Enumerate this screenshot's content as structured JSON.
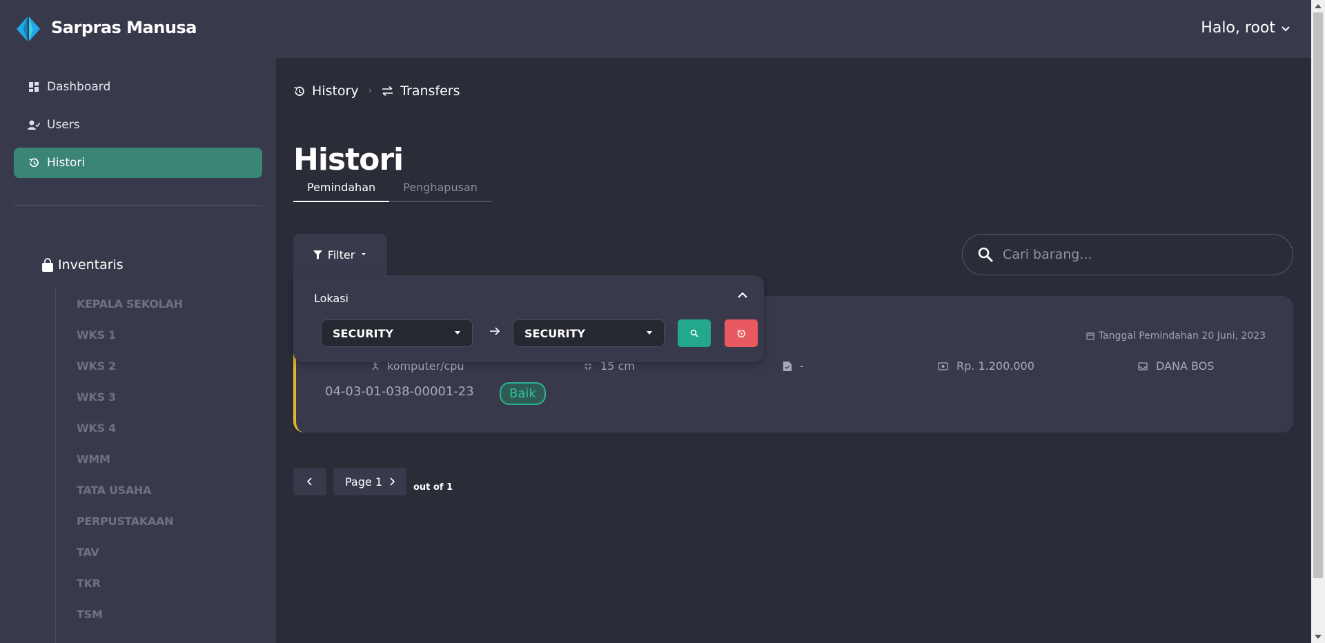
{
  "app": {
    "brand": "Sarpras Manusa",
    "user_greeting": "Halo, root"
  },
  "sidebar": {
    "items": [
      {
        "label": "Dashboard",
        "icon": "dashboard-icon"
      },
      {
        "label": "Users",
        "icon": "user-check-icon"
      },
      {
        "label": "Histori",
        "icon": "history-icon"
      }
    ],
    "inventory_title": "Inventaris",
    "inventory_items": [
      "KEPALA SEKOLAH",
      "WKS 1",
      "WKS 2",
      "WKS 3",
      "WKS 4",
      "WMM",
      "TATA USAHA",
      "PERPUSTAKAAN",
      "TAV",
      "TKR",
      "TSM"
    ]
  },
  "breadcrumb": {
    "history": "History",
    "transfers": "Transfers"
  },
  "page": {
    "title": "Histori"
  },
  "tabs": [
    "Pemindahan",
    "Penghapusan"
  ],
  "filter": {
    "label": "Filter",
    "panel_title": "Lokasi",
    "from": "SECURITY",
    "to": "SECURITY"
  },
  "search": {
    "placeholder": "Cari barang..."
  },
  "card": {
    "date": "Tanggal Pemindahan 20 Juni, 2023",
    "category": "komputer/cpu",
    "size": "15 cm",
    "note": "-",
    "price": "Rp. 1.200.000",
    "fund": "DANA BOS",
    "code": "04-03-01-038-00001-23",
    "condition": "Baik"
  },
  "pagination": {
    "current": "Page 1",
    "total": "out of 1"
  },
  "colors": {
    "accent": "#3b8577",
    "card_border": "#e0b82a",
    "success": "#23a88c",
    "danger": "#e85a5f"
  }
}
